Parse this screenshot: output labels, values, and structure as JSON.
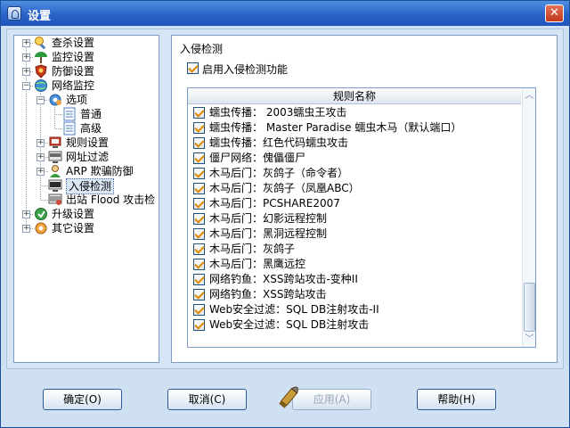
{
  "window": {
    "title": "设置"
  },
  "tree": {
    "items": [
      {
        "label": "查杀设置",
        "icon": "scan-icon"
      },
      {
        "label": "监控设置",
        "icon": "monitor-icon"
      },
      {
        "label": "防御设置",
        "icon": "defense-icon"
      },
      {
        "label": "网络监控",
        "icon": "network-icon"
      },
      {
        "label": "选项",
        "icon": "options-gear-icon"
      },
      {
        "label": "普通",
        "icon": "page-icon"
      },
      {
        "label": "高级",
        "icon": "page-icon"
      },
      {
        "label": "规则设置",
        "icon": "rules-icon"
      },
      {
        "label": "网址过滤",
        "icon": "url-filter-icon"
      },
      {
        "label": "ARP 欺骗防御",
        "icon": "arp-icon"
      },
      {
        "label": "入侵检测",
        "icon": "intrusion-icon"
      },
      {
        "label": "出站 Flood 攻击检",
        "icon": "flood-icon"
      },
      {
        "label": "升级设置",
        "icon": "upgrade-icon"
      },
      {
        "label": "其它设置",
        "icon": "other-settings-icon"
      }
    ]
  },
  "panel": {
    "title": "入侵检测",
    "enable_label": "启用入侵检测功能",
    "list_header": "规则名称",
    "rules": [
      "蠕虫传播： 2003蠕虫王攻击",
      "蠕虫传播： Master Paradise 蠕虫木马（默认端口）",
      "蠕虫传播：红色代码蠕虫攻击",
      "僵尸网络：傀儡僵尸",
      "木马后门：灰鸽子（命令者）",
      "木马后门：灰鸽子（凤凰ABC）",
      "木马后门：PCSHARE2007",
      "木马后门：幻影远程控制",
      "木马后门：黑洞远程控制",
      "木马后门：灰鸽子",
      "木马后门：黑鹰远控",
      "网络钓鱼：XSS跨站攻击-变种II",
      "网络钓鱼：XSS跨站攻击",
      "Web安全过滤：SQL DB注射攻击-II",
      "Web安全过滤：SQL DB注射攻击"
    ]
  },
  "buttons": {
    "ok": "确定(O)",
    "cancel": "取消(C)",
    "apply": "应用(A)",
    "help": "帮助(H)"
  }
}
